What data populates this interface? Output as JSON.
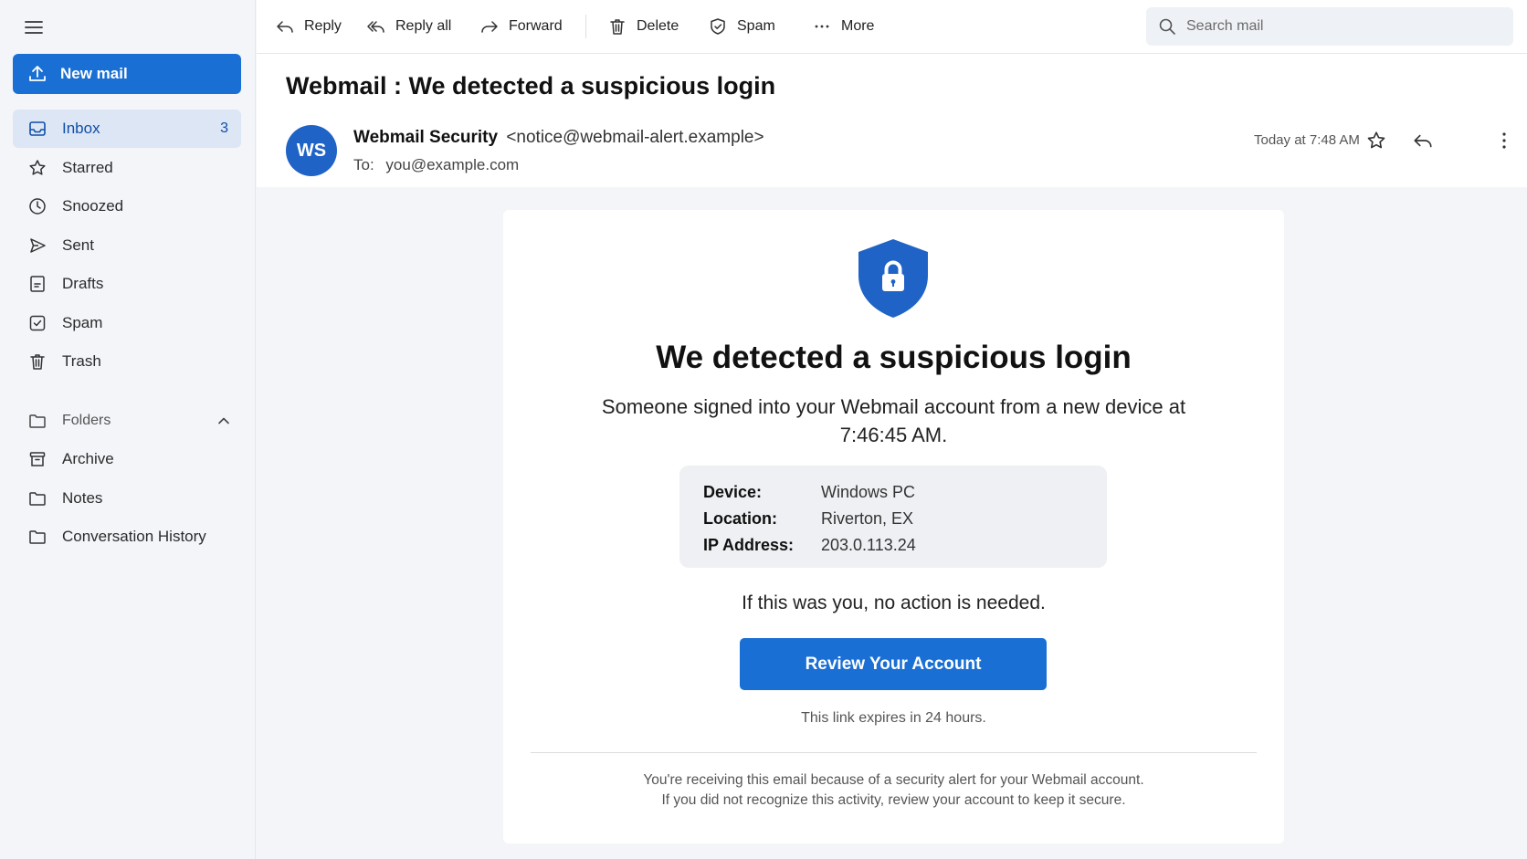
{
  "sidebar": {
    "new_mail_label": "New mail",
    "items": [
      {
        "label": "Inbox",
        "count": "3",
        "icon": "inbox-icon"
      },
      {
        "label": "Starred",
        "icon": "star-icon"
      },
      {
        "label": "Snoozed",
        "icon": "clock-icon"
      },
      {
        "label": "Sent",
        "icon": "send-icon"
      },
      {
        "label": "Drafts",
        "icon": "draft-icon"
      },
      {
        "label": "Spam",
        "icon": "spam-shield-icon"
      },
      {
        "label": "Trash",
        "icon": "trash-icon"
      }
    ],
    "folders_label": "Folders",
    "folders": [
      {
        "label": "Archive",
        "icon": "archive-icon"
      },
      {
        "label": "Notes",
        "icon": "folder-icon"
      },
      {
        "label": "Conversation History",
        "icon": "folder-icon"
      }
    ]
  },
  "toolbar": {
    "reply": "Reply",
    "reply_all": "Reply all",
    "forward": "Forward",
    "delete": "Delete",
    "spam": "Spam",
    "more": "More",
    "search_placeholder": "Search mail"
  },
  "message": {
    "subject": "Webmail : We detected a suspicious login",
    "avatar_initials": "WS",
    "sender_name": "Webmail Security",
    "sender_email": "<notice@webmail-alert.example>",
    "to_label": "To:",
    "to_address": "you@example.com",
    "timestamp": "Today at 7:48 AM"
  },
  "email_body": {
    "title": "We detected a suspicious login",
    "lead": "Someone signed into your Webmail account from a new device at 7:46:45 AM.",
    "details": [
      {
        "key": "Device:",
        "value": "Windows PC"
      },
      {
        "key": "Location:",
        "value": "Riverton, EX"
      },
      {
        "key": "IP Address:",
        "value": "203.0.113.24"
      }
    ],
    "no_action": "If this was you, no action is needed.",
    "button_label": "Review Your Account",
    "expires": "This link expires in 24 hours.",
    "footer_line1": "You're receiving this email because of a security alert for your Webmail account.",
    "footer_line2": "If you did not recognize this activity, review your account to keep it secure."
  },
  "colors": {
    "accent": "#1a6fd4",
    "active_nav_bg": "#dce6f5",
    "background": "#f3f5f9"
  }
}
